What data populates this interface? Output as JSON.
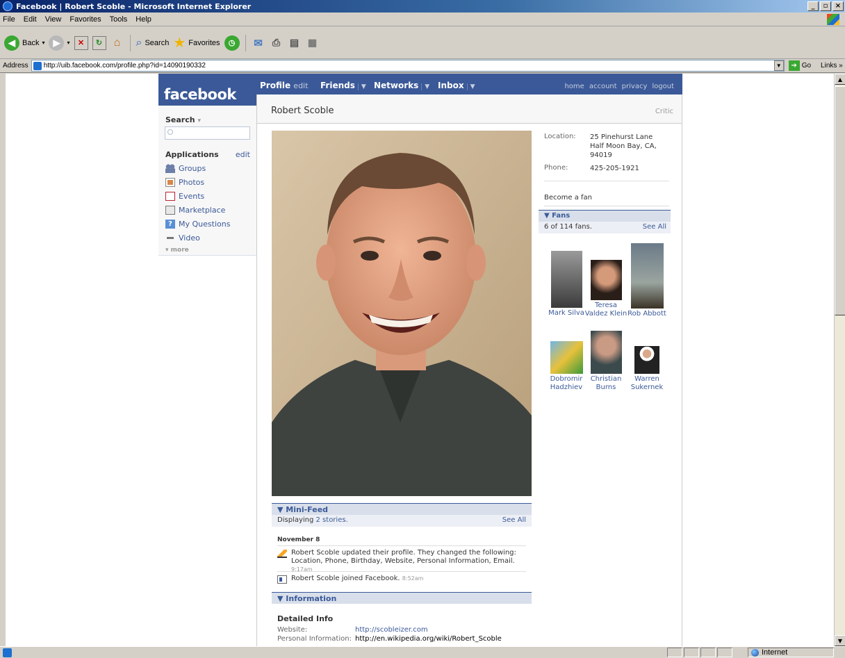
{
  "window": {
    "title": "Facebook | Robert Scoble - Microsoft Internet Explorer"
  },
  "menu": [
    "File",
    "Edit",
    "View",
    "Favorites",
    "Tools",
    "Help"
  ],
  "toolbar": {
    "back": "Back",
    "search": "Search",
    "favorites": "Favorites"
  },
  "address": {
    "label": "Address",
    "url": "http://uib.facebook.com/profile.php?id=14090190332",
    "go": "Go",
    "links": "Links"
  },
  "status": {
    "zone": "Internet"
  },
  "fb": {
    "logo": "facebook",
    "search_label": "Search",
    "applications": {
      "heading": "Applications",
      "edit": "edit",
      "items": [
        "Groups",
        "Photos",
        "Events",
        "Marketplace",
        "My Questions",
        "Video"
      ],
      "more": "more"
    },
    "nav": {
      "profile": "Profile",
      "edit": "edit",
      "friends": "Friends",
      "networks": "Networks",
      "inbox": "Inbox",
      "right": [
        "home",
        "account",
        "privacy",
        "logout"
      ]
    },
    "profile": {
      "name": "Robert Scoble",
      "network": "Critic",
      "location_label": "Location:",
      "location_line1": "25 Pinehurst Lane",
      "location_line2": "Half Moon Bay, CA,",
      "location_line3": "94019",
      "phone_label": "Phone:",
      "phone": "425-205-1921",
      "become_fan": "Become a fan"
    },
    "fans": {
      "heading": "Fans",
      "count_text": "6 of 114 fans.",
      "see_all": "See All",
      "items": [
        {
          "line1": "",
          "line2": "Mark Silva"
        },
        {
          "line1": "Teresa",
          "line2": "Valdez Klein"
        },
        {
          "line1": "",
          "line2": "Rob Abbott"
        },
        {
          "line1": "Dobromir",
          "line2": "Hadzhiev"
        },
        {
          "line1": "Christian",
          "line2": "Burns"
        },
        {
          "line1": "Warren",
          "line2": "Sukernek"
        }
      ]
    },
    "minifeed": {
      "heading": "Mini-Feed",
      "displaying_prefix": "Displaying",
      "stories_link": "2 stories.",
      "see_all": "See All",
      "date": "November 8",
      "story1_line1": "Robert Scoble updated their profile. They changed the following:",
      "story1_line2": "Location, Phone, Birthday, Website, Personal Information, Email.",
      "story1_time": "9:17am",
      "story2": "Robert Scoble joined Facebook.",
      "story2_time": "8:52am"
    },
    "information": {
      "heading": "Information",
      "detailed": "Detailed Info",
      "website_label": "Website:",
      "website": "http://scobleizer.com",
      "personal_label": "Personal Information:",
      "personal": "http://en.wikipedia.org/wiki/Robert_Scoble"
    }
  }
}
